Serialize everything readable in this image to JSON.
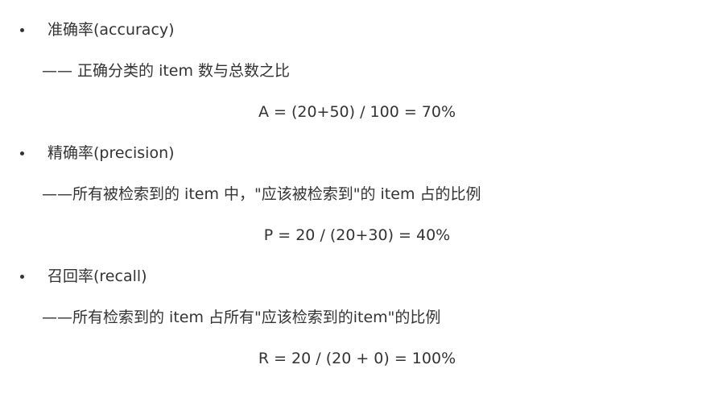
{
  "sections": [
    {
      "term": "准确率(accuracy)",
      "description": "—— 正确分类的 item 数与总数之比",
      "formula": "A = (20+50) / 100 = 70%"
    },
    {
      "term": "精确率(precision)",
      "description": "——所有被检索到的 item 中，\"应该被检索到\"的 item 占的比例",
      "formula": "P = 20 / (20+30) = 40%"
    },
    {
      "term": "召回率(recall)",
      "description": "——所有检索到的 item 占所有\"应该检索到的item\"的比例",
      "formula": "R = 20 / (20 + 0) = 100%"
    }
  ]
}
